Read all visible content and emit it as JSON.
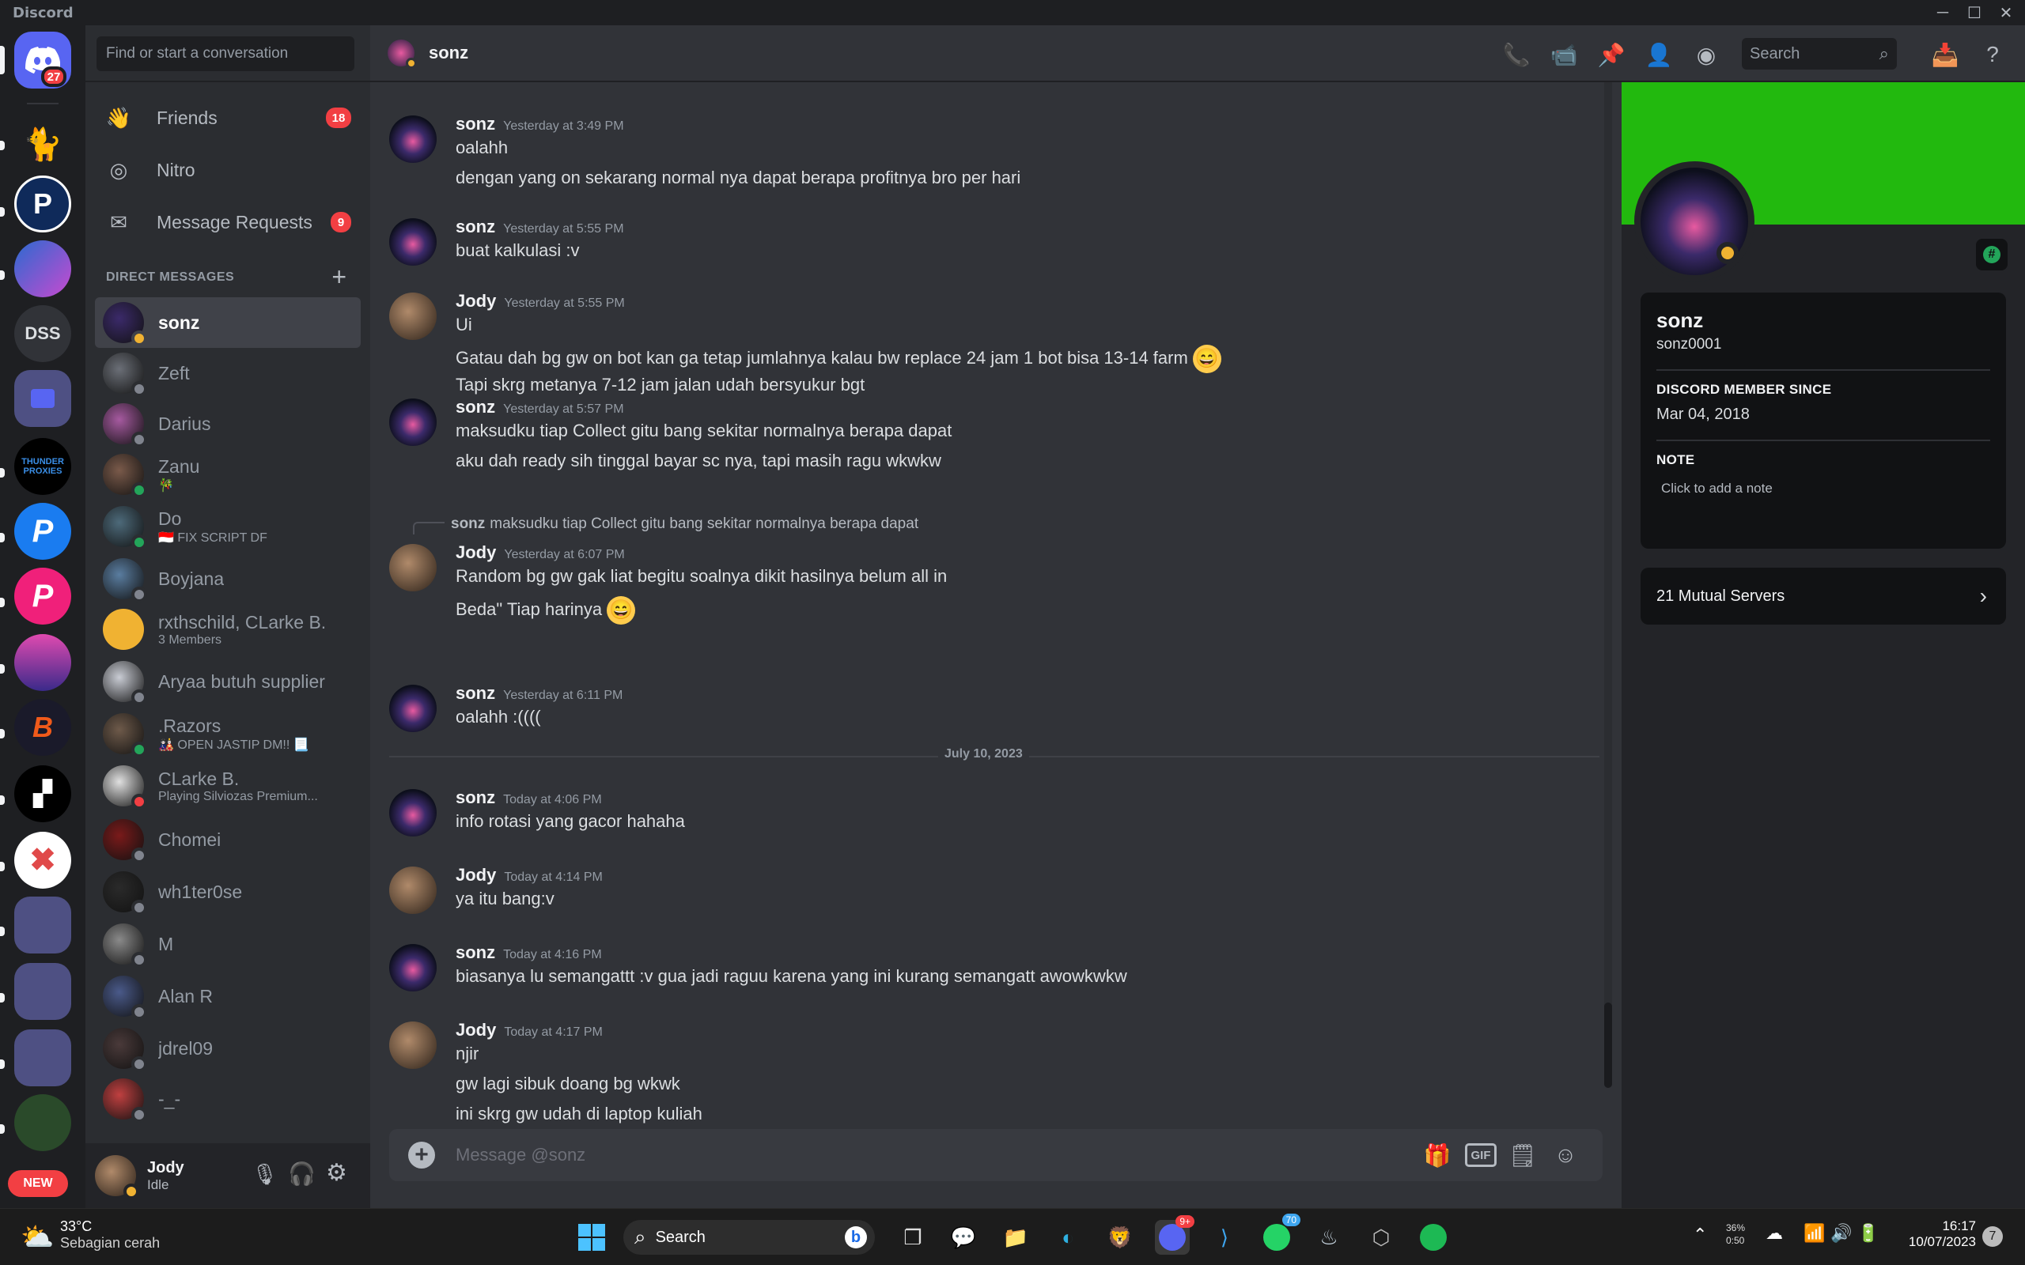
{
  "app_title": "Discord",
  "guilds": {
    "home_badge": "27",
    "dss_label": "DSS",
    "new_label": "NEW"
  },
  "dm_panel": {
    "search_placeholder": "Find or start a conversation",
    "nav": [
      {
        "label": "Friends",
        "badge": "18"
      },
      {
        "label": "Nitro",
        "badge": ""
      },
      {
        "label": "Message Requests",
        "badge": "9"
      }
    ],
    "header": "DIRECT MESSAGES",
    "items": [
      {
        "name": "sonz",
        "sub": "",
        "status": "idle",
        "color": "#3b2a6a"
      },
      {
        "name": "Zeft",
        "sub": "",
        "status": "offline",
        "color": "#6b6f77"
      },
      {
        "name": "Darius",
        "sub": "",
        "status": "offline",
        "color": "#a65aa0"
      },
      {
        "name": "Zanu",
        "sub": "🎋",
        "status": "online",
        "color": "#7a5a4a"
      },
      {
        "name": "Do",
        "sub": "🇮🇩 FIX SCRIPT DF",
        "status": "online",
        "color": "#4d6a7a"
      },
      {
        "name": "Boyjana",
        "sub": "",
        "status": "offline",
        "color": "#5a7da0"
      },
      {
        "name": "rxthschild, CLarke B.",
        "sub": "3 Members",
        "status": "group",
        "color": "#f0b232"
      },
      {
        "name": "Aryaa butuh supplier",
        "sub": "",
        "status": "offline",
        "color": "#c9ccd4"
      },
      {
        "name": ".Razors",
        "sub": "🎎 OPEN JASTIP DM!! 📃",
        "status": "online",
        "color": "#6e5a4a"
      },
      {
        "name": "CLarke B.",
        "sub": "Playing Silviozas Premium...",
        "status": "dnd",
        "color": "#e0e0e0"
      },
      {
        "name": "Chomei",
        "sub": "",
        "status": "offline",
        "color": "#7a1a1a"
      },
      {
        "name": "wh1ter0se",
        "sub": "",
        "status": "offline",
        "color": "#2a2a2a"
      },
      {
        "name": "M",
        "sub": "",
        "status": "offline",
        "color": "#8a8a8a"
      },
      {
        "name": "Alan R",
        "sub": "",
        "status": "offline",
        "color": "#4a5a8a"
      },
      {
        "name": "jdrel09",
        "sub": "",
        "status": "offline",
        "color": "#4a3a3a"
      },
      {
        "name": "-_-",
        "sub": "",
        "status": "offline",
        "color": "#c04040"
      }
    ]
  },
  "user_panel": {
    "name": "Jody",
    "status": "Idle"
  },
  "channel": {
    "name": "sonz",
    "search_placeholder": "Search",
    "composer_placeholder": "Message @sonz",
    "gif_label": "GIF"
  },
  "messages": [
    {
      "author": "sonz",
      "time": "Yesterday at 3:49 PM",
      "lines": [
        "oalahh",
        "dengan yang on sekarang normal nya dapat berapa profitnya bro per hari"
      ]
    },
    {
      "author": "sonz",
      "time": "Yesterday at 5:55 PM",
      "lines": [
        "buat kalkulasi :v"
      ]
    },
    {
      "author": "Jody",
      "time": "Yesterday at 5:55 PM",
      "lines": [
        "Ui",
        "Gatau dah bg gw on bot kan ga tetap jumlahnya kalau bw replace 24 jam 1 bot bisa 13-14 farm",
        "Tapi skrg metanya 7-12 jam jalan udah bersyukur bgt"
      ]
    },
    {
      "author": "sonz",
      "time": "Yesterday at 5:57 PM",
      "lines": [
        "maksudku tiap Collect gitu bang sekitar normalnya berapa dapat",
        "aku dah ready sih tinggal bayar sc nya, tapi masih ragu wkwkw"
      ]
    },
    {
      "author": "Jody",
      "time": "Yesterday at 6:07 PM",
      "reply_author": "sonz",
      "reply_text": "maksudku tiap Collect gitu bang sekitar normalnya berapa dapat",
      "lines": [
        "Random bg gw gak liat begitu soalnya dikit hasilnya belum all in",
        "Beda\" Tiap harinya"
      ]
    },
    {
      "author": "sonz",
      "time": "Yesterday at 6:11 PM",
      "lines": [
        "oalahh :(((("
      ]
    },
    {
      "author": "sonz",
      "time": "Today at 4:06 PM",
      "lines": [
        "info rotasi yang gacor hahaha"
      ]
    },
    {
      "author": "Jody",
      "time": "Today at 4:14 PM",
      "lines": [
        "ya itu bang:v"
      ]
    },
    {
      "author": "sonz",
      "time": "Today at 4:16 PM",
      "lines": [
        "biasanya lu semangattt :v gua jadi raguu karena yang ini kurang semangatt awowkwkw"
      ]
    },
    {
      "author": "Jody",
      "time": "Today at 4:17 PM",
      "lines": [
        "njir",
        "gw lagi sibuk doang bg wkwk",
        "ini skrg gw udah di laptop kuliah"
      ]
    }
  ],
  "date_divider": "July 10, 2023",
  "profile": {
    "display_name": "sonz",
    "username": "sonz0001",
    "member_since_label": "DISCORD MEMBER SINCE",
    "member_since": "Mar 04, 2018",
    "note_label": "NOTE",
    "note_placeholder": "Click to add a note",
    "mutual_servers": "21 Mutual Servers",
    "banner_color": "#22b90e"
  },
  "taskbar": {
    "weather_temp": "33°C",
    "weather_desc": "Sebagian cerah",
    "search": "Search",
    "discord_badge": "9+",
    "whatsapp_badge": "70",
    "battery_pct": "36%",
    "battery_time": "0:50",
    "time": "16:17",
    "date": "10/07/2023",
    "notif_count": "7"
  }
}
